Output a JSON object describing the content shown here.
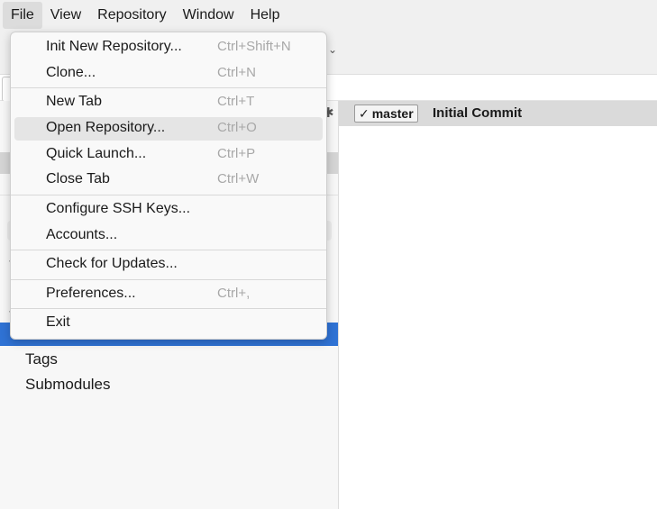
{
  "menubar": {
    "items": [
      "File",
      "View",
      "Repository",
      "Window",
      "Help"
    ]
  },
  "file_menu": {
    "items": [
      {
        "label": "Init New Repository...",
        "shortcut": "Ctrl+Shift+N"
      },
      {
        "label": "Clone...",
        "shortcut": "Ctrl+N"
      },
      {
        "label": "New Tab",
        "shortcut": "Ctrl+T"
      },
      {
        "label": "Open Repository...",
        "shortcut": "Ctrl+O"
      },
      {
        "label": "Quick Launch...",
        "shortcut": "Ctrl+P"
      },
      {
        "label": "Close Tab",
        "shortcut": "Ctrl+W"
      },
      {
        "label": "Configure SSH Keys...",
        "shortcut": ""
      },
      {
        "label": "Accounts...",
        "shortcut": ""
      },
      {
        "label": "Check for Updates...",
        "shortcut": ""
      },
      {
        "label": "Preferences...",
        "shortcut": "Ctrl+,"
      },
      {
        "label": "Exit",
        "shortcut": ""
      }
    ]
  },
  "sidebar": {
    "items": [
      "Tags",
      "Submodules"
    ]
  },
  "commits": {
    "first": {
      "branch": "master",
      "message": "Initial Commit"
    }
  },
  "colors": {
    "selection": "#2f72d4",
    "menu_hover": "#e5e5e5",
    "shortcut_text": "#a8a8a8"
  },
  "icons": {
    "branch_check": "✓",
    "gear": "✱",
    "chevron": "⌄"
  }
}
